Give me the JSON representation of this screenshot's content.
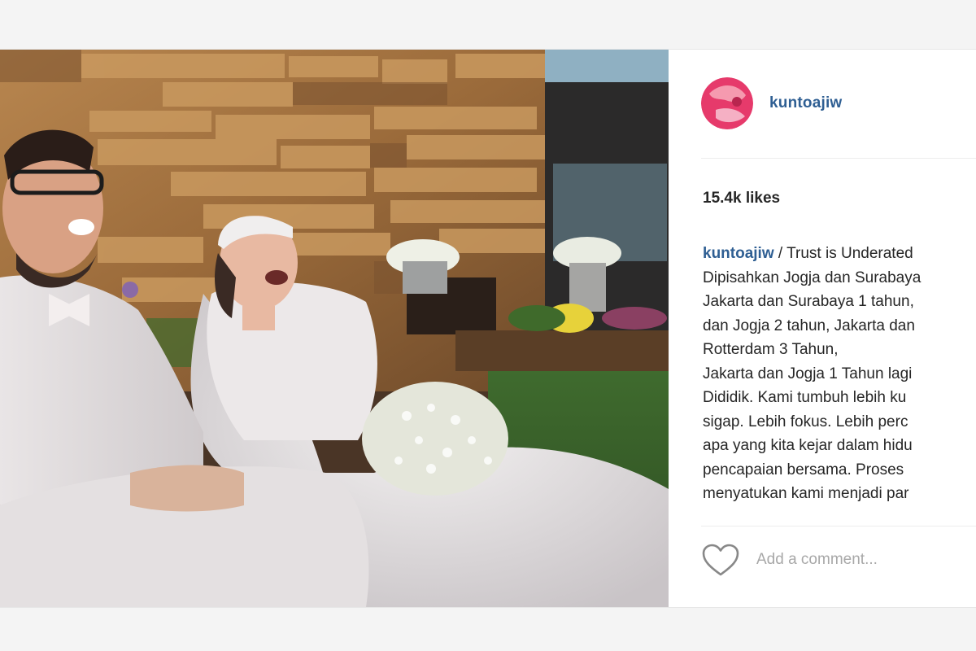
{
  "post": {
    "username": "kuntoajiw",
    "likes": "15.4k likes",
    "caption": {
      "username": "kuntoajiw",
      "lines": [
        " / Trust is Underated",
        "Dipisahkan Jogja dan Surabaya",
        "Jakarta dan Surabaya 1 tahun,",
        "dan Jogja 2 tahun, Jakarta dan",
        "Rotterdam 3 Tahun,",
        "Jakarta dan Jogja 1 Tahun lagi",
        "Dididik. Kami tumbuh lebih ku",
        "sigap. Lebih fokus. Lebih perc",
        "apa yang kita kejar dalam hidu",
        "pencapaian bersama. Proses",
        "menyatukan kami menjadi par"
      ]
    },
    "comment_placeholder": "Add a comment..."
  },
  "icons": {
    "like": "heart-icon",
    "avatar": "profile-avatar"
  },
  "colors": {
    "username": "#2f5f93",
    "text": "#262626",
    "placeholder": "#a8a8a8",
    "avatar_bg": "#e63a6b"
  }
}
